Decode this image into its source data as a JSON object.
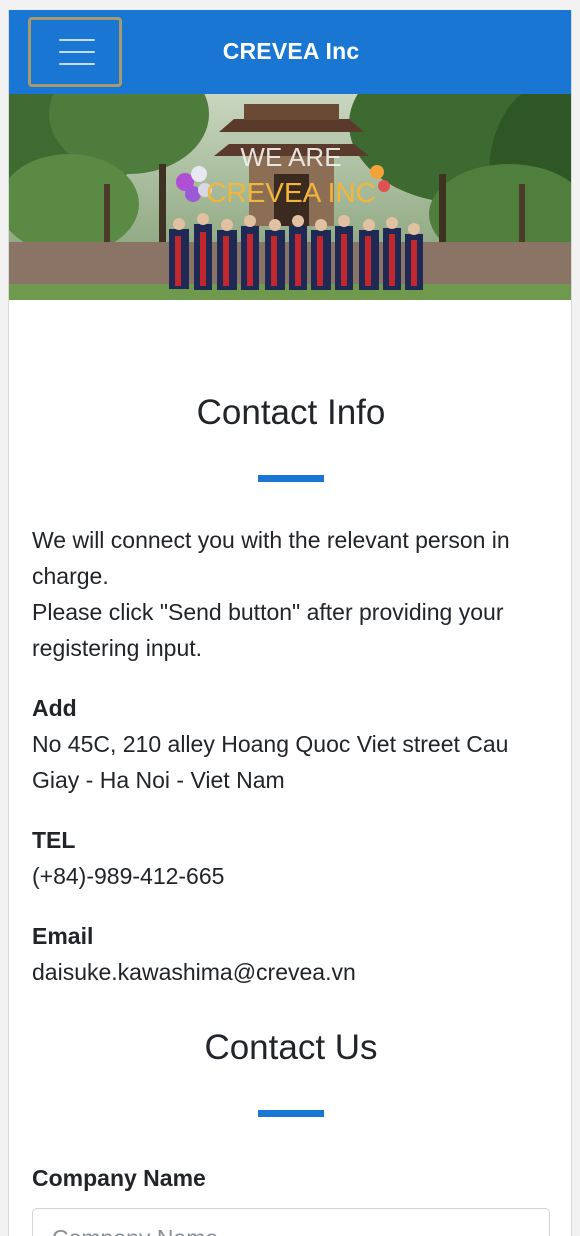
{
  "header": {
    "brand": "CREVEA Inc"
  },
  "hero": {
    "overlay_line1": "WE ARE",
    "overlay_line2": "CREVEA INC"
  },
  "contact_info": {
    "title": "Contact Info",
    "intro_line1": "We will connect you with the relevant person in charge.",
    "intro_line2": "Please click \"Send button\" after providing your registering input.",
    "address_label": "Add",
    "address_value": "No 45C, 210 alley Hoang Quoc Viet street Cau Giay - Ha Noi - Viet Nam",
    "tel_label": "TEL",
    "tel_value": "(+84)-989-412-665",
    "email_label": "Email",
    "email_value": "daisuke.kawashima@crevea.vn"
  },
  "contact_us": {
    "title": "Contact Us",
    "company_label": "Company Name",
    "company_placeholder": "Company Name"
  },
  "colors": {
    "primary": "#1976d2",
    "text": "#212529",
    "menu_border": "#a89a6e"
  },
  "icons": {
    "menu": "hamburger-menu-icon"
  }
}
